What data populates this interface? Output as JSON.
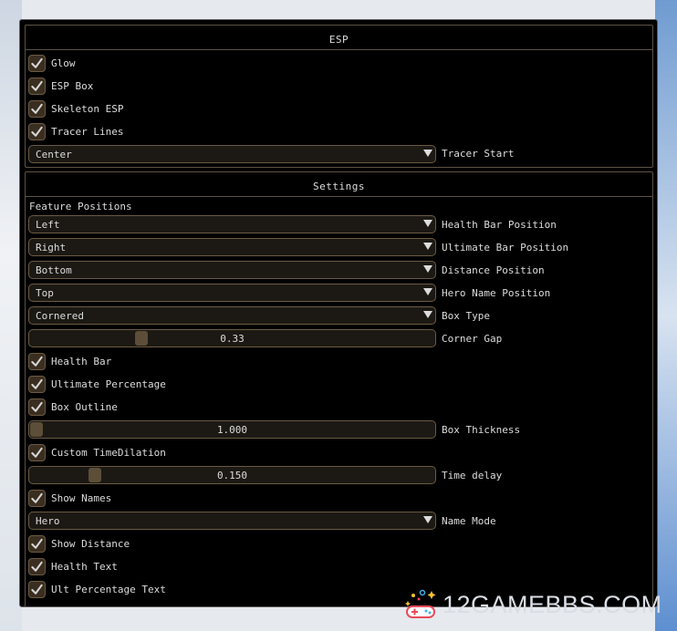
{
  "esp": {
    "title": "ESP",
    "checkboxes": [
      "Glow",
      "ESP Box",
      "Skeleton ESP",
      "Tracer Lines"
    ],
    "tracer_start": {
      "value": "Center",
      "label": "Tracer Start"
    }
  },
  "settings": {
    "title": "Settings",
    "feature_positions": "Feature Positions",
    "health_bar_position": {
      "value": "Left",
      "label": "Health Bar Position"
    },
    "ultimate_bar_position": {
      "value": "Right",
      "label": "Ultimate Bar Position"
    },
    "distance_position": {
      "value": "Bottom",
      "label": "Distance Position"
    },
    "hero_name_position": {
      "value": "Top",
      "label": "Hero Name Position"
    },
    "box_type": {
      "value": "Cornered",
      "label": "Box Type"
    },
    "corner_gap": {
      "value": "0.33",
      "label": "Corner Gap",
      "fraction": 0.27
    },
    "health_bar": "Health Bar",
    "ultimate_percentage": "Ultimate Percentage",
    "box_outline": "Box Outline",
    "box_thickness": {
      "value": "1.000",
      "label": "Box Thickness",
      "fraction": 0.0
    },
    "custom_time_dilation": "Custom TimeDilation",
    "time_delay": {
      "value": "0.150",
      "label": "Time delay",
      "fraction": 0.15
    },
    "show_names": "Show Names",
    "name_mode": {
      "value": "Hero",
      "label": "Name Mode"
    },
    "show_distance": "Show Distance",
    "health_text": "Health Text",
    "ult_percentage_text": "Ult Percentage Text"
  },
  "watermark": {
    "text": "12GAMEBBS.COM"
  },
  "colors": {
    "background": "#000000",
    "accent_border": "#6b5a43",
    "check_box_fill": "#3a2e20",
    "slider_grab": "#5c4e38",
    "text": "#dcdcdc"
  }
}
